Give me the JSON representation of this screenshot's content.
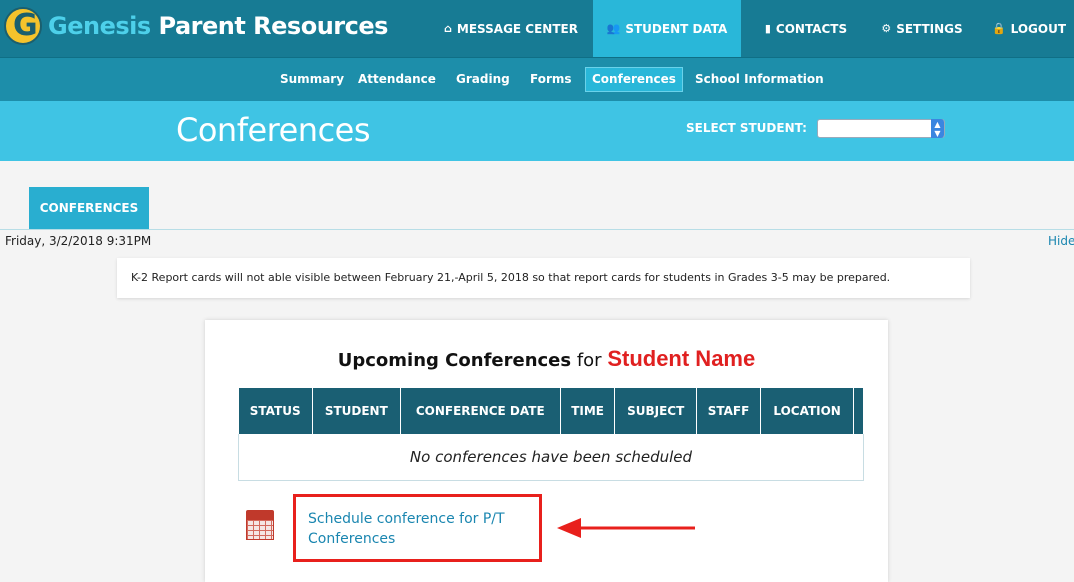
{
  "app": {
    "logo_letter": "G",
    "brand_genesis": "Genesis",
    "brand_rest": " Parent Resources"
  },
  "topnav": [
    {
      "label": "MESSAGE CENTER",
      "icon": "home-icon",
      "glyph": "⌂"
    },
    {
      "label": "STUDENT DATA",
      "icon": "users-icon",
      "glyph": "👥",
      "active": true
    },
    {
      "label": "CONTACTS",
      "icon": "book-icon",
      "glyph": "▮"
    },
    {
      "label": "SETTINGS",
      "icon": "gear-icon",
      "glyph": "⚙"
    },
    {
      "label": "LOGOUT",
      "icon": "lock-icon",
      "glyph": "🔒"
    }
  ],
  "subnav": [
    "Summary",
    "Attendance",
    "Grading",
    "Forms",
    "Conferences",
    "School Information"
  ],
  "subnav_active": "Conferences",
  "page": {
    "title": "Conferences",
    "select_label": "SELECT STUDENT:",
    "select_value": ""
  },
  "tab": {
    "label": "CONFERENCES"
  },
  "datetime": "Friday, 3/2/2018 9:31PM",
  "hide_link": "Hide",
  "notice": "K-2 Report cards will not able visible between February 21,-April 5, 2018 so that report cards for students in Grades 3-5 may be prepared.",
  "card": {
    "title_bold": "Upcoming Conferences",
    "title_for": " for ",
    "title_name": "Student Name",
    "columns": [
      "STATUS",
      "STUDENT",
      "CONFERENCE DATE",
      "TIME",
      "SUBJECT",
      "STAFF",
      "LOCATION",
      ""
    ],
    "empty_message": "No conferences have been scheduled",
    "schedule_link": "Schedule conference for P/T Conferences"
  },
  "colors": {
    "topbar": "#177b94",
    "active_nav": "#29b7d9",
    "title_band": "#3fc4e4",
    "table_header": "#1a5f73",
    "highlight": "#e8201c",
    "student_name": "#e02020"
  }
}
